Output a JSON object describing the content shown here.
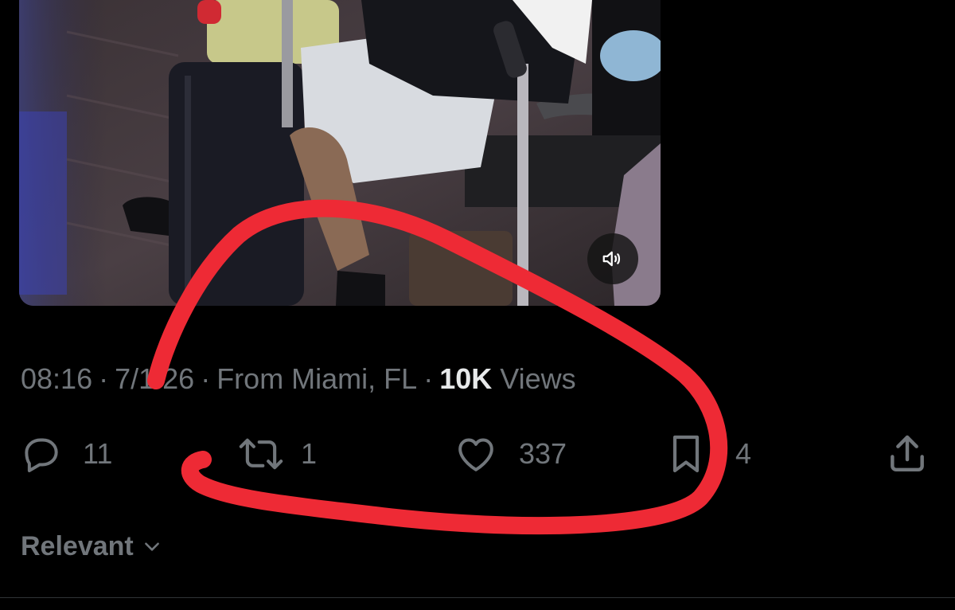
{
  "tweet": {
    "video": {
      "mute_icon": "speaker-volume-icon"
    },
    "meta": {
      "time": "08:16",
      "date": "7/​1/26",
      "location": "From Miami, FL",
      "separator": "·",
      "views_count": "10K",
      "views_label": "Views"
    },
    "actions": {
      "replies": {
        "icon": "reply-icon",
        "count": "11"
      },
      "reposts": {
        "icon": "repost-icon",
        "count": "1"
      },
      "likes": {
        "icon": "heart-icon",
        "count": "337"
      },
      "bookmarks": {
        "icon": "bookmark-icon",
        "count": "4"
      },
      "share": {
        "icon": "share-icon"
      }
    }
  },
  "replies_sort": {
    "label": "Relevant",
    "icon": "chevron-down-icon"
  },
  "annotation": {
    "color": "#ee2a35"
  }
}
